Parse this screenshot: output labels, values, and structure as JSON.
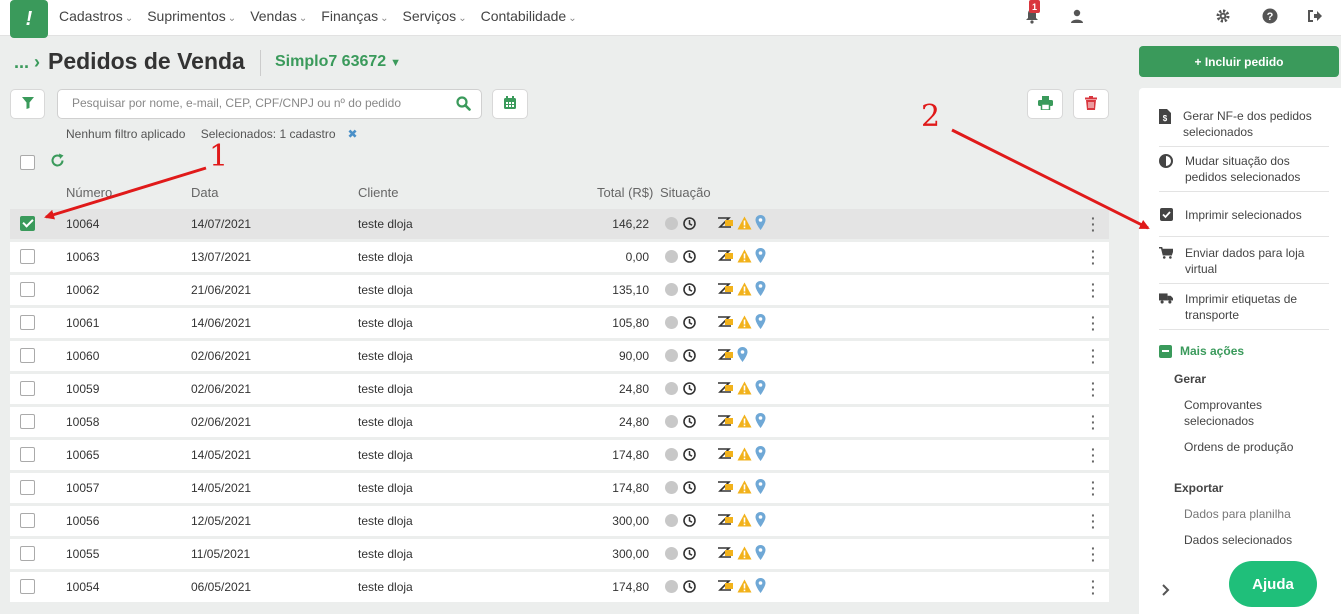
{
  "nav": {
    "logo": "!",
    "items": [
      "Cadastros",
      "Suprimentos",
      "Vendas",
      "Finanças",
      "Serviços",
      "Contabilidade"
    ],
    "notifications_count": "1"
  },
  "header": {
    "breadcrumb": "...",
    "title": "Pedidos de Venda",
    "account": "Simplo7 63672"
  },
  "search": {
    "placeholder": "Pesquisar por nome, e-mail, CEP, CPF/CNPJ ou nº do pedido",
    "value": ""
  },
  "filters": {
    "status": "Nenhum filtro aplicado",
    "selected": "Selecionados: 1 cadastro"
  },
  "table": {
    "columns": [
      "Número",
      "Data",
      "Cliente",
      "Total (R$)",
      "Situação"
    ],
    "rows": [
      {
        "number": "10064",
        "date": "14/07/2021",
        "client": "teste dloja",
        "total": "146,22",
        "selected": true,
        "warn": true
      },
      {
        "number": "10063",
        "date": "13/07/2021",
        "client": "teste dloja",
        "total": "0,00",
        "selected": false,
        "warn": true
      },
      {
        "number": "10062",
        "date": "21/06/2021",
        "client": "teste dloja",
        "total": "135,10",
        "selected": false,
        "warn": true
      },
      {
        "number": "10061",
        "date": "14/06/2021",
        "client": "teste dloja",
        "total": "105,80",
        "selected": false,
        "warn": true
      },
      {
        "number": "10060",
        "date": "02/06/2021",
        "client": "teste dloja",
        "total": "90,00",
        "selected": false,
        "warn": false
      },
      {
        "number": "10059",
        "date": "02/06/2021",
        "client": "teste dloja",
        "total": "24,80",
        "selected": false,
        "warn": true
      },
      {
        "number": "10058",
        "date": "02/06/2021",
        "client": "teste dloja",
        "total": "24,80",
        "selected": false,
        "warn": true
      },
      {
        "number": "10065",
        "date": "14/05/2021",
        "client": "teste dloja",
        "total": "174,80",
        "selected": false,
        "warn": true
      },
      {
        "number": "10057",
        "date": "14/05/2021",
        "client": "teste dloja",
        "total": "174,80",
        "selected": false,
        "warn": true
      },
      {
        "number": "10056",
        "date": "12/05/2021",
        "client": "teste dloja",
        "total": "300,00",
        "selected": false,
        "warn": true
      },
      {
        "number": "10055",
        "date": "11/05/2021",
        "client": "teste dloja",
        "total": "300,00",
        "selected": false,
        "warn": true
      },
      {
        "number": "10054",
        "date": "06/05/2021",
        "client": "teste dloja",
        "total": "174,80",
        "selected": false,
        "warn": true
      }
    ]
  },
  "panel": {
    "primary_button": "+ Incluir pedido",
    "actions": [
      "Gerar NF-e dos pedidos selecionados",
      "Mudar situação dos pedidos selecionados",
      "Imprimir selecionados",
      "Enviar dados para loja virtual",
      "Imprimir etiquetas de transporte"
    ],
    "more_label": "Mais ações",
    "group_gerar": "Gerar",
    "gerar_items": [
      "Comprovantes selecionados",
      "Ordens de produção"
    ],
    "group_exportar": "Exportar",
    "exportar_items": [
      "Dados para planilha",
      "Dados selecionados"
    ]
  },
  "help_button": "Ajuda",
  "annotations": [
    "1",
    "2"
  ],
  "colors": {
    "brand": "#3a9a5b",
    "danger": "#d9363e",
    "warning": "#f2b21b",
    "help": "#1fbf7a",
    "annotation": "#e01a1a"
  }
}
